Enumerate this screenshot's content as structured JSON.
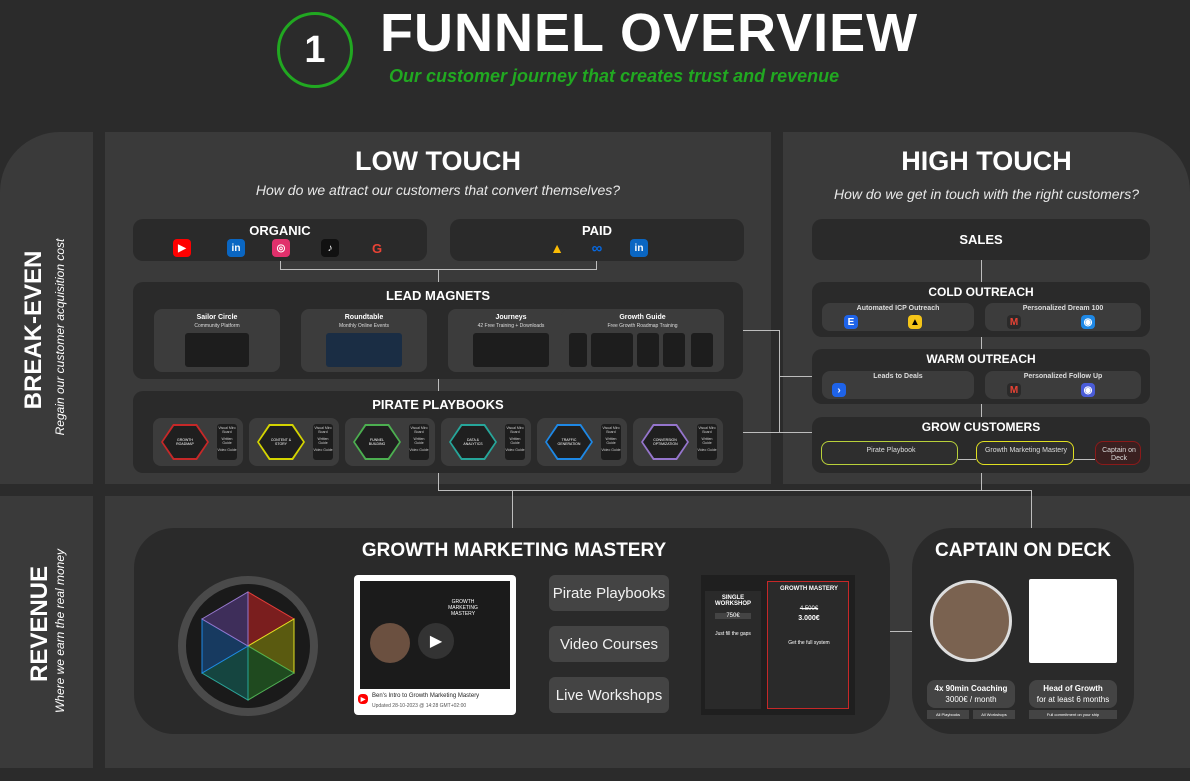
{
  "header": {
    "step_number": "1",
    "title": "FUNNEL OVERVIEW",
    "subtitle": "Our customer journey that creates trust and revenue"
  },
  "side_labels": {
    "break_even": "BREAK-EVEN",
    "break_even_sub": "Regain our customer acquisition cost",
    "revenue": "REVENUE",
    "revenue_sub": "Where we earn the real money"
  },
  "low_touch": {
    "title": "LOW TOUCH",
    "question": "How do we attract our customers that convert themselves?",
    "organic": "ORGANIC",
    "paid": "PAID",
    "lead_magnets": {
      "title": "LEAD MAGNETS",
      "items": [
        {
          "name": "Sailor Circle",
          "desc": "Community Platform"
        },
        {
          "name": "Roundtable",
          "desc": "Monthly Online Events"
        },
        {
          "name": "Journeys",
          "desc": "42 Free Training + Downloads"
        },
        {
          "name": "Growth Guide",
          "desc": "Free Growth Roadmap Training"
        }
      ]
    },
    "pirate_playbooks": {
      "title": "PIRATE PLAYBOOKS",
      "items": [
        {
          "hex": "GROWTH ROADMAP",
          "color": "#c62828"
        },
        {
          "hex": "CONTENT & STORY",
          "color": "#d4d400"
        },
        {
          "hex": "FUNNEL BUILDING",
          "color": "#4caf50"
        },
        {
          "hex": "DATA & ANALYTICS",
          "color": "#26a69a"
        },
        {
          "hex": "TRAFFIC GENERATION",
          "color": "#1e88e5"
        },
        {
          "hex": "CONVERSION OPTIMIZATION",
          "color": "#9575cd"
        }
      ],
      "side_labels": [
        "Visual Miro Board",
        "Written Guide",
        "Video Guide"
      ]
    }
  },
  "high_touch": {
    "title": "HIGH TOUCH",
    "question": "How do we get in touch with the right customers?",
    "sales": "SALES",
    "cold_outreach": {
      "title": "COLD OUTREACH",
      "left": "Automated ICP Outreach",
      "right": "Personalized Dream 100"
    },
    "warm_outreach": {
      "title": "WARM OUTREACH",
      "left": "Leads to Deals",
      "right": "Personalized Follow Up"
    },
    "grow_customers": {
      "title": "GROW CUSTOMERS",
      "items": [
        "Pirate Playbook",
        "Growth Marketing Mastery",
        "Captain on Deck"
      ]
    }
  },
  "gmm": {
    "title": "GROWTH MARKETING MASTERY",
    "video_title": "Ben's Intro to Growth Marketing Mastery",
    "video_updated": "Updated 28-10-2023 @ 14:28 GMT+02:00",
    "video_card": "GROWTH MARKETING MASTERY",
    "pills": [
      "Pirate Playbooks",
      "Video Courses",
      "Live Workshops"
    ],
    "single_workshop": {
      "title": "SINGLE WORKSHOP",
      "price": "750€",
      "gap": "Just fill the gaps"
    },
    "growth_mastery": {
      "title": "GROWTH MASTERY",
      "old_price": "4.500€",
      "price": "3.000€",
      "system": "Get the full system"
    },
    "wheel": [
      "GROWTH ROADMAP",
      "CONTENT & STORY",
      "FUNNEL BUILDING",
      "DATA ANALYTICS",
      "TRAFFIC GENERATION",
      "CONVERSION OPTIMIZATION"
    ]
  },
  "cod": {
    "title": "CAPTAIN ON DECK",
    "coaching_title": "4x 90min Coaching",
    "coaching_price": "3000€ / month",
    "head_title": "Head of Growth",
    "head_duration": "for at least 6 months",
    "tag_playbooks": "All Playbooks",
    "tag_workshops": "All Workshops",
    "tag_commitment": "Full commitment on your ship"
  },
  "colors": {
    "green": "#21a821",
    "youtube": "#ff0000",
    "linkedin": "#0a66c2",
    "instagram": "#e1306c",
    "meta": "#0668e1",
    "gmm_border": "#c6d620",
    "cod_border": "#8b1a1a"
  }
}
